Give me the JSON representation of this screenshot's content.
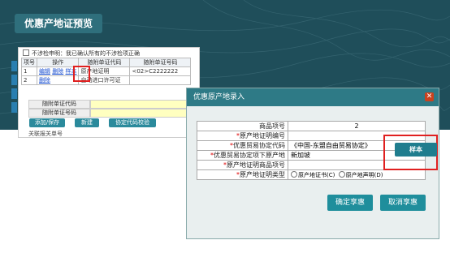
{
  "slide": {
    "title": "优惠产地证预览"
  },
  "background_panel": {
    "notice_label": "不涉检申明：我已确认所有的不涉检项正确",
    "table": {
      "headers": [
        "项号",
        "操作",
        "随附单证代码",
        "随附单证号码"
      ],
      "rows": [
        {
          "no": "1",
          "edit": "编辑",
          "del": "删除",
          "sample": "样本",
          "code": "原产地证明",
          "number": "<02>C2222222"
        },
        {
          "no": "2",
          "edit": "",
          "del": "删除",
          "sample": "",
          "code": "自动进口许可证",
          "number": ""
        }
      ]
    },
    "field1_label": "随附单证代码",
    "field2_label": "随附单证号码",
    "btn_add_save": "添加/保存",
    "btn_new": "新建",
    "btn_agreement_check": "协定代码校验",
    "cut_label": "关联报关单号"
  },
  "dialog": {
    "title": "优惠原产地录入",
    "close": "✕",
    "rows": [
      {
        "label": "商品项号",
        "required": false,
        "value": "2"
      },
      {
        "label": "原产地证明编号",
        "required": true,
        "value": ""
      },
      {
        "label": "优惠贸易协定代码",
        "required": true,
        "value": "《中国-东盟自由贸易协定》"
      },
      {
        "label": "优惠贸易协定项下原产地",
        "required": true,
        "value": "新加坡"
      },
      {
        "label": "原产地证明商品项号",
        "required": true,
        "value": ""
      },
      {
        "label": "原产地证明类型",
        "required": true,
        "value": ""
      }
    ],
    "radio_cert": "原产地证书(C)",
    "radio_decl": "原产地声明(D)",
    "sample_button": "样本",
    "confirm_button": "确定享惠",
    "cancel_button": "取消享惠"
  },
  "colors": {
    "teal": "#1f8e9c",
    "dark_bg": "#1f4e5a",
    "highlight": "#e02020"
  }
}
